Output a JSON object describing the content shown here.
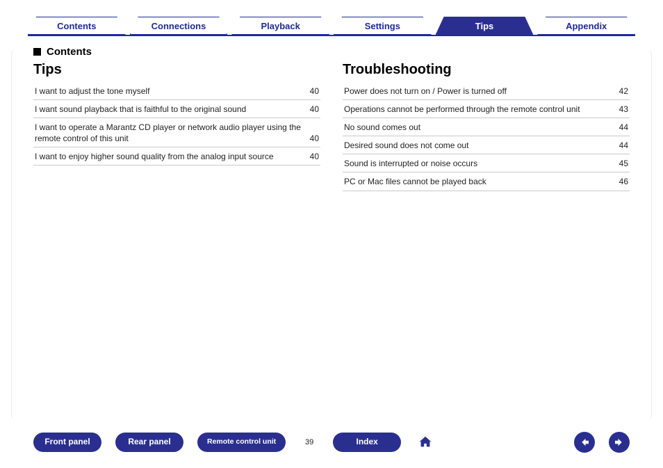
{
  "tabs": [
    {
      "label": "Contents",
      "active": false
    },
    {
      "label": "Connections",
      "active": false
    },
    {
      "label": "Playback",
      "active": false
    },
    {
      "label": "Settings",
      "active": false
    },
    {
      "label": "Tips",
      "active": true
    },
    {
      "label": "Appendix",
      "active": false
    }
  ],
  "contents_label": "Contents",
  "left_section": {
    "heading": "Tips",
    "items": [
      {
        "text": "I want to adjust the tone myself",
        "page": "40"
      },
      {
        "text": "I want sound playback that is faithful to the original sound",
        "page": "40"
      },
      {
        "text": "I want to operate a Marantz CD player or network audio player using the remote control of this unit",
        "page": "40"
      },
      {
        "text": "I want to enjoy higher sound quality from the analog input source",
        "page": "40"
      }
    ]
  },
  "right_section": {
    "heading": "Troubleshooting",
    "items": [
      {
        "text": "Power does not turn on / Power is turned off",
        "page": "42"
      },
      {
        "text": "Operations cannot be performed through the remote control unit",
        "page": "43"
      },
      {
        "text": "No sound comes out",
        "page": "44"
      },
      {
        "text": "Desired sound does not come out",
        "page": "44"
      },
      {
        "text": "Sound is interrupted or noise occurs",
        "page": "45"
      },
      {
        "text": "PC or Mac files cannot be played back",
        "page": "46"
      }
    ]
  },
  "bottom": {
    "buttons": [
      {
        "id": "front-panel",
        "label": "Front panel"
      },
      {
        "id": "rear-panel",
        "label": "Rear panel"
      },
      {
        "id": "remote-ctrl",
        "label": "Remote control unit"
      },
      {
        "id": "index",
        "label": "Index"
      }
    ],
    "page_number": "39"
  }
}
